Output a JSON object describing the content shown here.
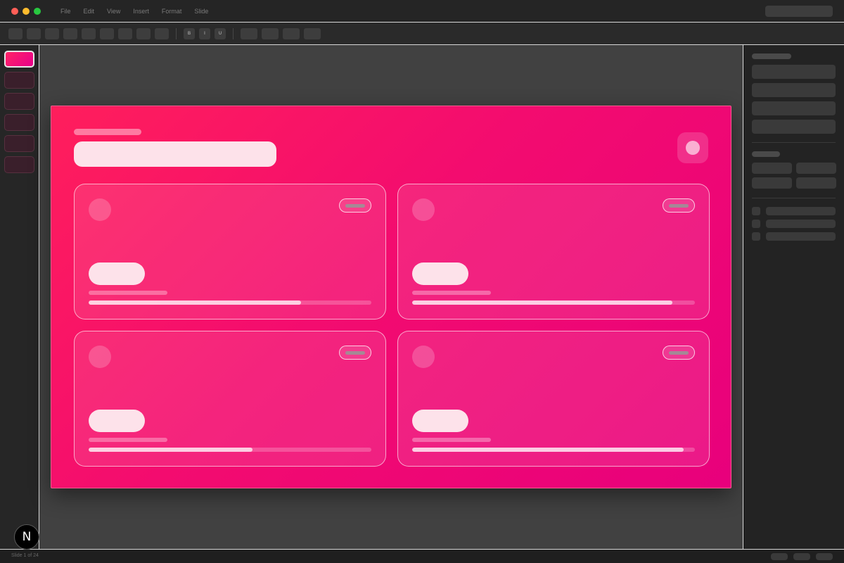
{
  "window": {
    "menu": [
      "File",
      "Edit",
      "View",
      "Insert",
      "Format",
      "Slide"
    ]
  },
  "toolbar": {
    "format_buttons": [
      "B",
      "I",
      "U"
    ]
  },
  "slide": {
    "accent_start": "#ff1e5c",
    "accent_end": "#e8007c",
    "cards": [
      {
        "progress": 0.75
      },
      {
        "progress": 0.92
      },
      {
        "progress": 0.58
      },
      {
        "progress": 0.96
      }
    ]
  },
  "status": {
    "slide_counter": "Slide 1 of 24"
  },
  "badge": {
    "letter": "N"
  },
  "colors": {
    "window_bg": "#1e1e1e",
    "canvas_bg": "#414141",
    "slide_accent": "#ff1e5c",
    "card_value": "#fde2ea"
  }
}
